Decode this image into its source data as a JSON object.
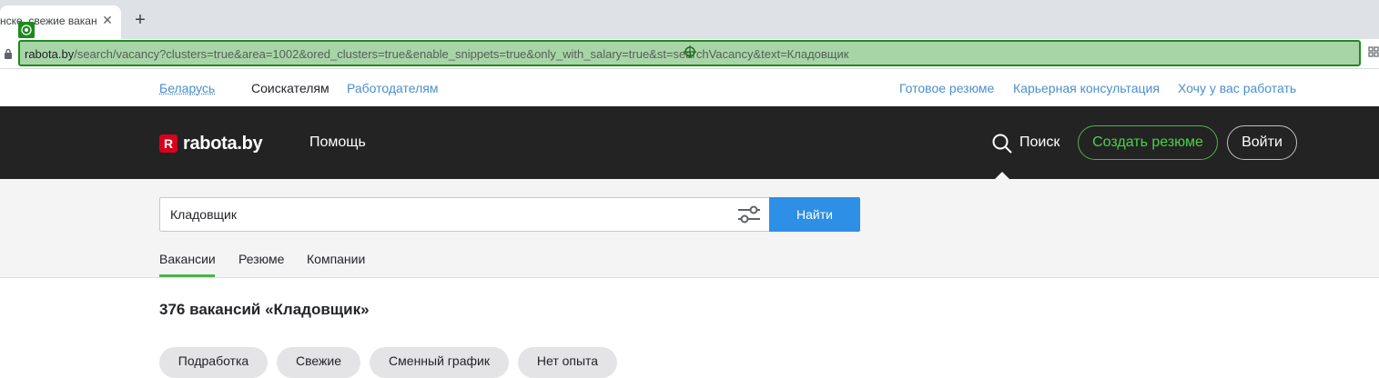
{
  "browser": {
    "tab_title": "нске, свежие вакан",
    "tab_close_glyph": "✕",
    "new_tab_glyph": "+",
    "url_host": "rabota.by",
    "url_path": "/search/vacancy?clusters=true&area=1002&ored_clusters=true&enable_snippets=true&only_with_salary=true&st=searchVacancy&text=Кладовщик"
  },
  "toplinks": {
    "region": "Беларусь",
    "seekers": "Соискателям",
    "employers": "Работодателям",
    "ready_resume": "Готовое резюме",
    "career": "Карьерная консультация",
    "want_work": "Хочу у вас работать"
  },
  "header": {
    "logo_badge": "R",
    "logo_text": "rabota.by",
    "help": "Помощь",
    "search": "Поиск",
    "create_resume": "Создать резюме",
    "login": "Войти"
  },
  "search": {
    "query": "Кладовщик",
    "find_button": "Найти",
    "tabs": [
      "Вакансии",
      "Резюме",
      "Компании"
    ]
  },
  "results": {
    "title": "376 вакансий «Кладовщик»",
    "chips": [
      "Подработка",
      "Свежие",
      "Сменный график",
      "Нет опыта"
    ]
  },
  "colors": {
    "header_bg": "#232323",
    "accent_green": "#4bb34b",
    "button_blue": "#2e8fe6",
    "link_blue": "#4a8fcb",
    "logo_red": "#d6001c",
    "omnibox_highlight": "#a8d5a8"
  }
}
